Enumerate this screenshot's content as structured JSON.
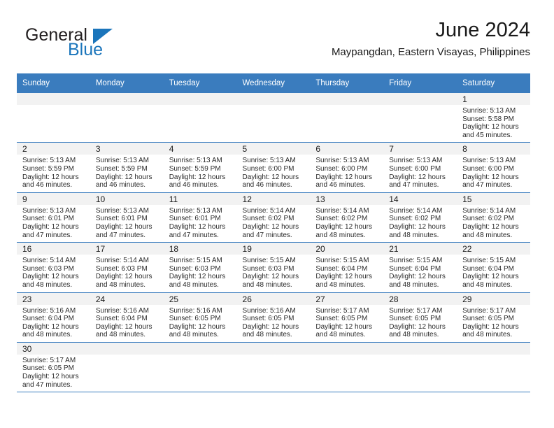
{
  "brand": {
    "name_top": "General",
    "name_bottom": "Blue",
    "triangle_color": "#1b75bb"
  },
  "header": {
    "title": "June 2024",
    "location": "Maypangdan, Eastern Visayas, Philippines"
  },
  "theme": {
    "header_blue": "#3a7cbe",
    "row_band_gray": "#f2f2f2",
    "text": "#1a1a1a"
  },
  "weekdays": [
    "Sunday",
    "Monday",
    "Tuesday",
    "Wednesday",
    "Thursday",
    "Friday",
    "Saturday"
  ],
  "weeks": [
    [
      {
        "day": "",
        "empty": true
      },
      {
        "day": "",
        "empty": true
      },
      {
        "day": "",
        "empty": true
      },
      {
        "day": "",
        "empty": true
      },
      {
        "day": "",
        "empty": true
      },
      {
        "day": "",
        "empty": true
      },
      {
        "day": "1",
        "sunrise": "Sunrise: 5:13 AM",
        "sunset": "Sunset: 5:58 PM",
        "daylight1": "Daylight: 12 hours",
        "daylight2": "and 45 minutes."
      }
    ],
    [
      {
        "day": "2",
        "sunrise": "Sunrise: 5:13 AM",
        "sunset": "Sunset: 5:59 PM",
        "daylight1": "Daylight: 12 hours",
        "daylight2": "and 46 minutes."
      },
      {
        "day": "3",
        "sunrise": "Sunrise: 5:13 AM",
        "sunset": "Sunset: 5:59 PM",
        "daylight1": "Daylight: 12 hours",
        "daylight2": "and 46 minutes."
      },
      {
        "day": "4",
        "sunrise": "Sunrise: 5:13 AM",
        "sunset": "Sunset: 5:59 PM",
        "daylight1": "Daylight: 12 hours",
        "daylight2": "and 46 minutes."
      },
      {
        "day": "5",
        "sunrise": "Sunrise: 5:13 AM",
        "sunset": "Sunset: 6:00 PM",
        "daylight1": "Daylight: 12 hours",
        "daylight2": "and 46 minutes."
      },
      {
        "day": "6",
        "sunrise": "Sunrise: 5:13 AM",
        "sunset": "Sunset: 6:00 PM",
        "daylight1": "Daylight: 12 hours",
        "daylight2": "and 46 minutes."
      },
      {
        "day": "7",
        "sunrise": "Sunrise: 5:13 AM",
        "sunset": "Sunset: 6:00 PM",
        "daylight1": "Daylight: 12 hours",
        "daylight2": "and 47 minutes."
      },
      {
        "day": "8",
        "sunrise": "Sunrise: 5:13 AM",
        "sunset": "Sunset: 6:00 PM",
        "daylight1": "Daylight: 12 hours",
        "daylight2": "and 47 minutes."
      }
    ],
    [
      {
        "day": "9",
        "sunrise": "Sunrise: 5:13 AM",
        "sunset": "Sunset: 6:01 PM",
        "daylight1": "Daylight: 12 hours",
        "daylight2": "and 47 minutes."
      },
      {
        "day": "10",
        "sunrise": "Sunrise: 5:13 AM",
        "sunset": "Sunset: 6:01 PM",
        "daylight1": "Daylight: 12 hours",
        "daylight2": "and 47 minutes."
      },
      {
        "day": "11",
        "sunrise": "Sunrise: 5:13 AM",
        "sunset": "Sunset: 6:01 PM",
        "daylight1": "Daylight: 12 hours",
        "daylight2": "and 47 minutes."
      },
      {
        "day": "12",
        "sunrise": "Sunrise: 5:14 AM",
        "sunset": "Sunset: 6:02 PM",
        "daylight1": "Daylight: 12 hours",
        "daylight2": "and 47 minutes."
      },
      {
        "day": "13",
        "sunrise": "Sunrise: 5:14 AM",
        "sunset": "Sunset: 6:02 PM",
        "daylight1": "Daylight: 12 hours",
        "daylight2": "and 48 minutes."
      },
      {
        "day": "14",
        "sunrise": "Sunrise: 5:14 AM",
        "sunset": "Sunset: 6:02 PM",
        "daylight1": "Daylight: 12 hours",
        "daylight2": "and 48 minutes."
      },
      {
        "day": "15",
        "sunrise": "Sunrise: 5:14 AM",
        "sunset": "Sunset: 6:02 PM",
        "daylight1": "Daylight: 12 hours",
        "daylight2": "and 48 minutes."
      }
    ],
    [
      {
        "day": "16",
        "sunrise": "Sunrise: 5:14 AM",
        "sunset": "Sunset: 6:03 PM",
        "daylight1": "Daylight: 12 hours",
        "daylight2": "and 48 minutes."
      },
      {
        "day": "17",
        "sunrise": "Sunrise: 5:14 AM",
        "sunset": "Sunset: 6:03 PM",
        "daylight1": "Daylight: 12 hours",
        "daylight2": "and 48 minutes."
      },
      {
        "day": "18",
        "sunrise": "Sunrise: 5:15 AM",
        "sunset": "Sunset: 6:03 PM",
        "daylight1": "Daylight: 12 hours",
        "daylight2": "and 48 minutes."
      },
      {
        "day": "19",
        "sunrise": "Sunrise: 5:15 AM",
        "sunset": "Sunset: 6:03 PM",
        "daylight1": "Daylight: 12 hours",
        "daylight2": "and 48 minutes."
      },
      {
        "day": "20",
        "sunrise": "Sunrise: 5:15 AM",
        "sunset": "Sunset: 6:04 PM",
        "daylight1": "Daylight: 12 hours",
        "daylight2": "and 48 minutes."
      },
      {
        "day": "21",
        "sunrise": "Sunrise: 5:15 AM",
        "sunset": "Sunset: 6:04 PM",
        "daylight1": "Daylight: 12 hours",
        "daylight2": "and 48 minutes."
      },
      {
        "day": "22",
        "sunrise": "Sunrise: 5:15 AM",
        "sunset": "Sunset: 6:04 PM",
        "daylight1": "Daylight: 12 hours",
        "daylight2": "and 48 minutes."
      }
    ],
    [
      {
        "day": "23",
        "sunrise": "Sunrise: 5:16 AM",
        "sunset": "Sunset: 6:04 PM",
        "daylight1": "Daylight: 12 hours",
        "daylight2": "and 48 minutes."
      },
      {
        "day": "24",
        "sunrise": "Sunrise: 5:16 AM",
        "sunset": "Sunset: 6:04 PM",
        "daylight1": "Daylight: 12 hours",
        "daylight2": "and 48 minutes."
      },
      {
        "day": "25",
        "sunrise": "Sunrise: 5:16 AM",
        "sunset": "Sunset: 6:05 PM",
        "daylight1": "Daylight: 12 hours",
        "daylight2": "and 48 minutes."
      },
      {
        "day": "26",
        "sunrise": "Sunrise: 5:16 AM",
        "sunset": "Sunset: 6:05 PM",
        "daylight1": "Daylight: 12 hours",
        "daylight2": "and 48 minutes."
      },
      {
        "day": "27",
        "sunrise": "Sunrise: 5:17 AM",
        "sunset": "Sunset: 6:05 PM",
        "daylight1": "Daylight: 12 hours",
        "daylight2": "and 48 minutes."
      },
      {
        "day": "28",
        "sunrise": "Sunrise: 5:17 AM",
        "sunset": "Sunset: 6:05 PM",
        "daylight1": "Daylight: 12 hours",
        "daylight2": "and 48 minutes."
      },
      {
        "day": "29",
        "sunrise": "Sunrise: 5:17 AM",
        "sunset": "Sunset: 6:05 PM",
        "daylight1": "Daylight: 12 hours",
        "daylight2": "and 48 minutes."
      }
    ],
    [
      {
        "day": "30",
        "sunrise": "Sunrise: 5:17 AM",
        "sunset": "Sunset: 6:05 PM",
        "daylight1": "Daylight: 12 hours",
        "daylight2": "and 47 minutes."
      },
      {
        "day": "",
        "empty": true
      },
      {
        "day": "",
        "empty": true
      },
      {
        "day": "",
        "empty": true
      },
      {
        "day": "",
        "empty": true
      },
      {
        "day": "",
        "empty": true
      },
      {
        "day": "",
        "empty": true
      }
    ]
  ]
}
